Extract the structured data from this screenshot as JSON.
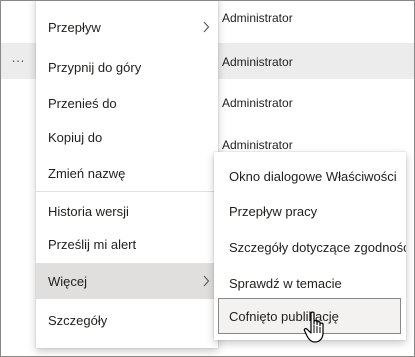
{
  "list": {
    "more_icon": "…",
    "rows": [
      {
        "modified_by": "Administrator"
      },
      {
        "modified_by": "Administrator"
      },
      {
        "modified_by": "Administrator"
      },
      {
        "modified_by": "Administrator"
      }
    ]
  },
  "context_menu": {
    "items": [
      {
        "label": "Przepływ",
        "has_submenu": true
      },
      {
        "label": "Przypnij do góry"
      },
      {
        "label": "Przenieś do"
      },
      {
        "label": "Kopiuj do"
      },
      {
        "label": "Zmień nazwę"
      },
      {
        "label": "Historia wersji"
      },
      {
        "label": "Prześlij mi alert"
      },
      {
        "label": "Więcej",
        "has_submenu": true,
        "active": true
      },
      {
        "label": "Szczegóły"
      }
    ],
    "chevron_icon": "chevron-right-icon"
  },
  "submenu": {
    "items": [
      {
        "label": "Okno dialogowe Właściwości"
      },
      {
        "label": "Przepływ pracy"
      },
      {
        "label": "Szczegóły dotyczące zgodności"
      },
      {
        "label": "Sprawdź w temacie"
      },
      {
        "label": "Cofnięto publikację",
        "hovered": true
      }
    ]
  },
  "colors": {
    "active_item_bg": "#e1dfdd",
    "selected_row_bg": "#ececec",
    "border": "#8a8886"
  }
}
